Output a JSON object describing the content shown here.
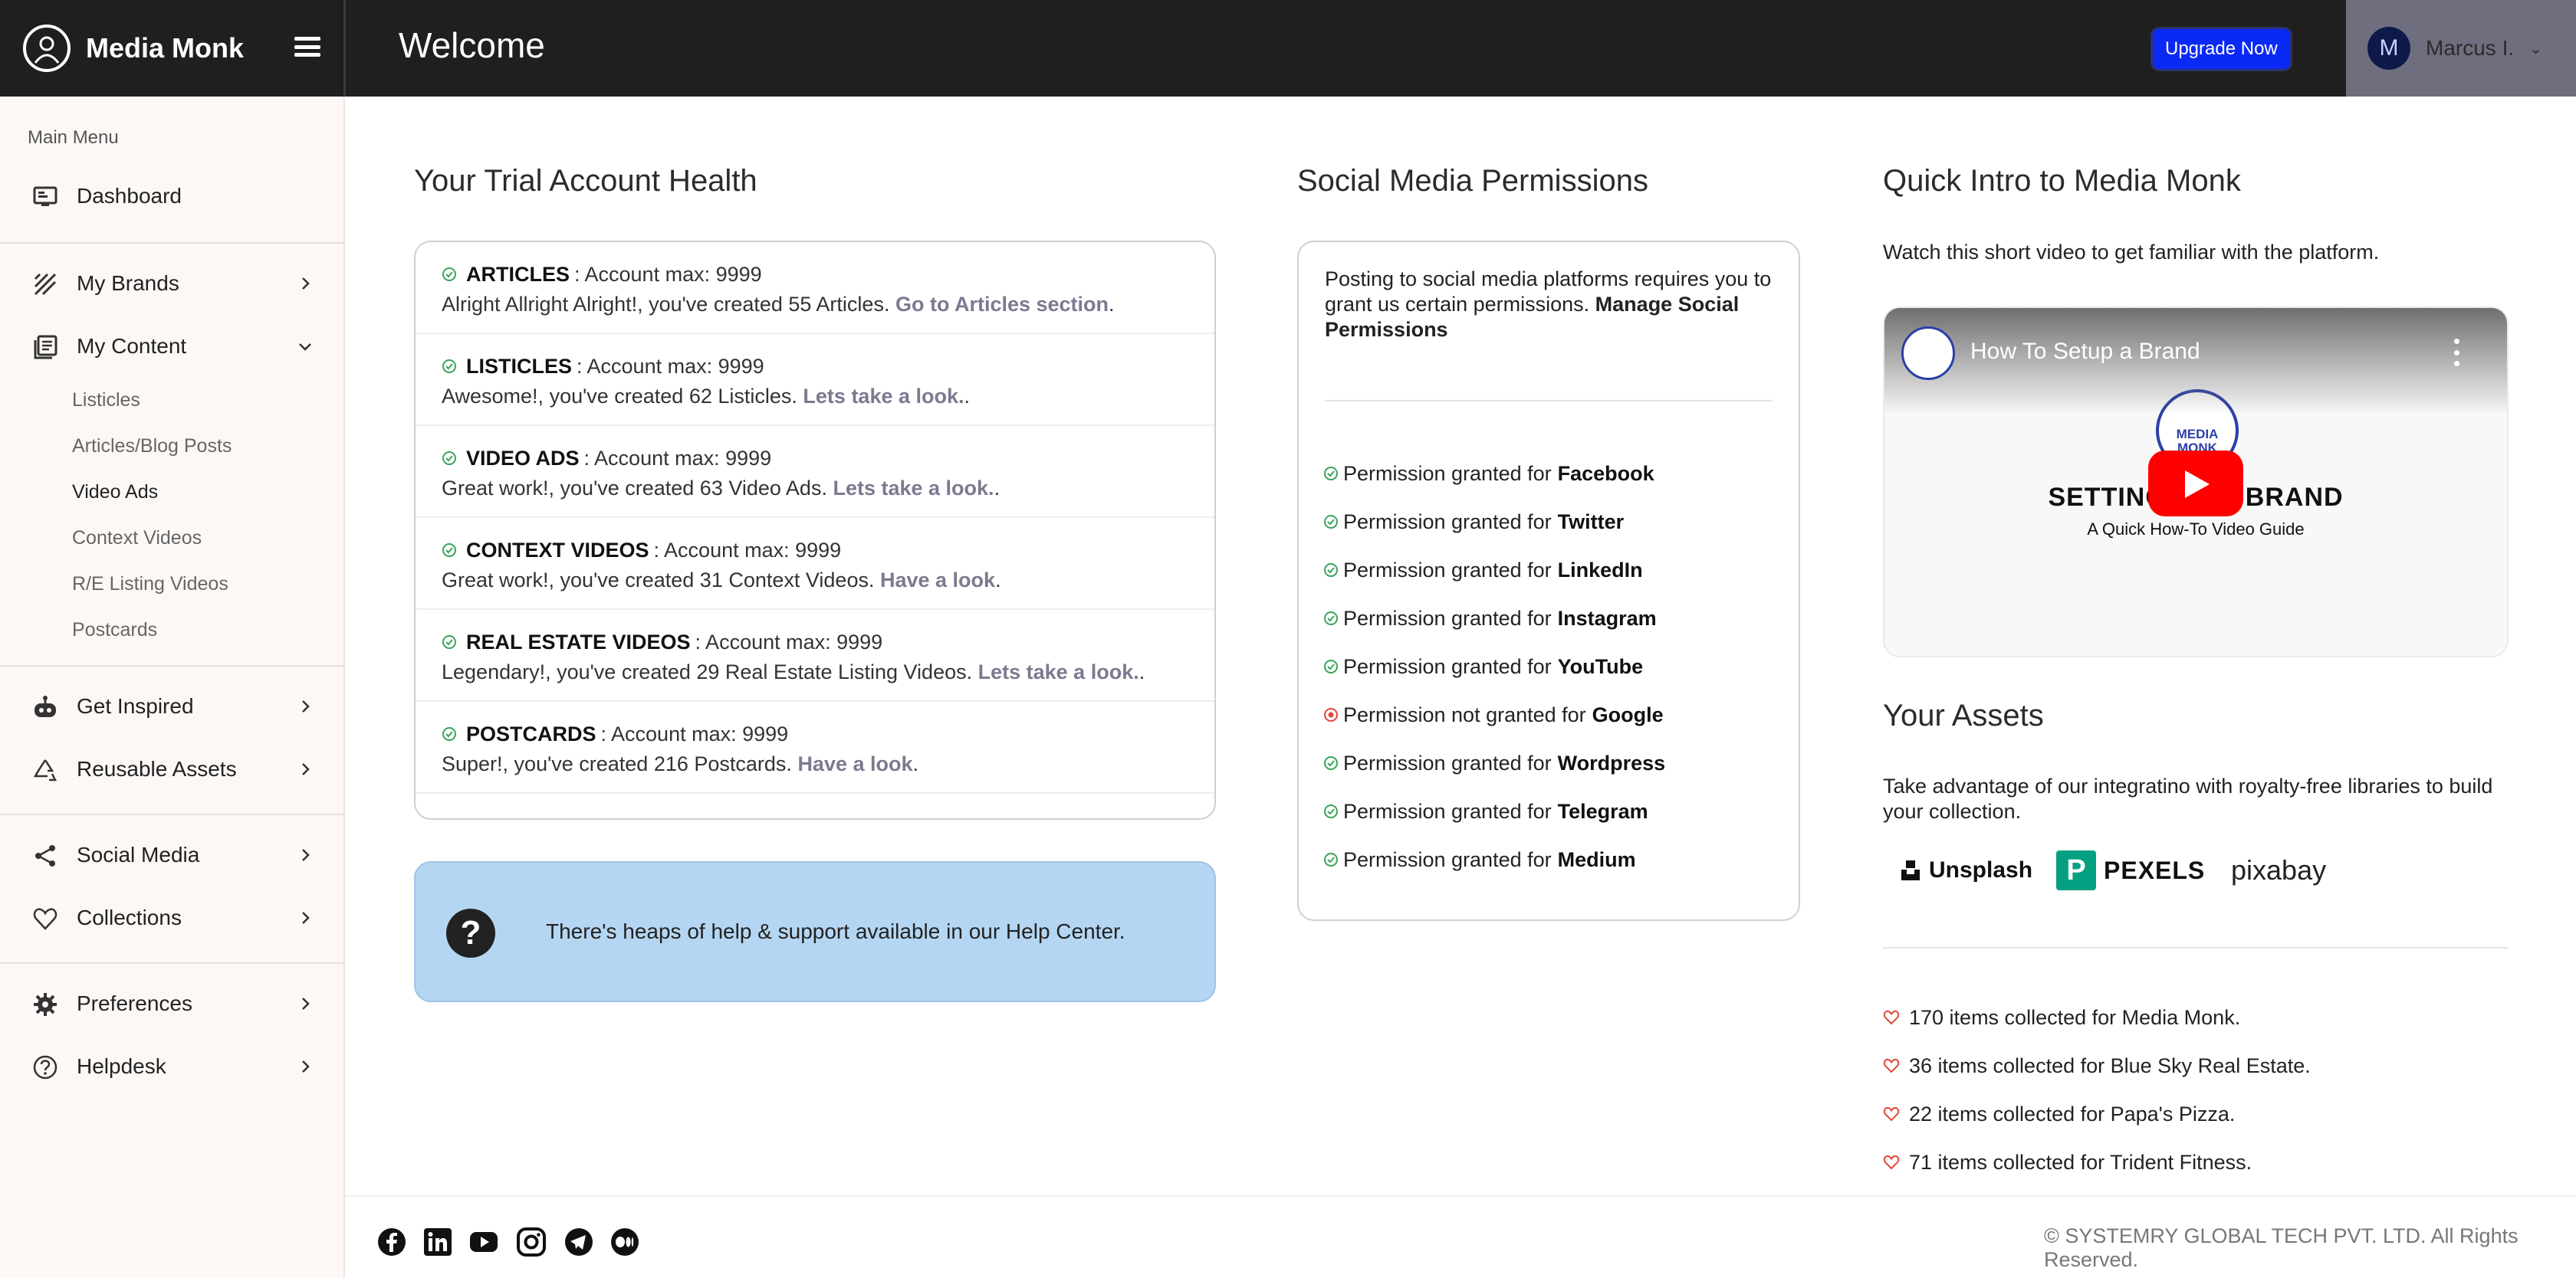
{
  "app": {
    "name": "Media Monk"
  },
  "header": {
    "title": "Welcome",
    "upgrade_label": "Upgrade Now",
    "user": {
      "initial": "M",
      "name": "Marcus I."
    }
  },
  "sidebar": {
    "heading": "Main Menu",
    "items": [
      {
        "label": "Dashboard",
        "icon": "monitor-icon"
      },
      {
        "label": "My Brands",
        "icon": "brands-icon"
      },
      {
        "label": "My Content",
        "icon": "content-icon",
        "expanded": true
      },
      {
        "label": "Get Inspired",
        "icon": "robot-icon"
      },
      {
        "label": "Reusable Assets",
        "icon": "recycle-icon"
      },
      {
        "label": "Social Media",
        "icon": "share-icon"
      },
      {
        "label": "Collections",
        "icon": "heart-icon"
      },
      {
        "label": "Preferences",
        "icon": "gear-icon"
      },
      {
        "label": "Helpdesk",
        "icon": "question-icon"
      }
    ],
    "content_sub": [
      "Listicles",
      "Articles/Blog Posts",
      "Video Ads",
      "Context Videos",
      "R/E Listing Videos",
      "Postcards"
    ],
    "active_sub": "Video Ads"
  },
  "health": {
    "title": "Your Trial Account Health",
    "rows": [
      {
        "type": "ARTICLES",
        "max": ": Account max: 9999",
        "message": "Alright Allright Alright!, you've created 55 Articles.",
        "link": "Go to Articles section",
        "tail": "."
      },
      {
        "type": "LISTICLES",
        "max": ": Account max: 9999",
        "message": "Awesome!, you've created 62 Listicles.",
        "link": "Lets take a look.",
        "tail": "."
      },
      {
        "type": "VIDEO ADS",
        "max": ": Account max: 9999",
        "message": "Great work!, you've created 63 Video Ads.",
        "link": "Lets take a look.",
        "tail": "."
      },
      {
        "type": "CONTEXT VIDEOS",
        "max": ": Account max: 9999",
        "message": "Great work!, you've created 31 Context Videos.",
        "link": "Have a look",
        "tail": "."
      },
      {
        "type": "REAL ESTATE VIDEOS",
        "max": ": Account max: 9999",
        "message": "Legendary!, you've created 29 Real Estate Listing Videos.",
        "link": "Lets take a look.",
        "tail": "."
      },
      {
        "type": "POSTCARDS",
        "max": ": Account max: 9999",
        "message": "Super!, you've created 216 Postcards.",
        "link": "Have a look",
        "tail": "."
      }
    ]
  },
  "help": {
    "text": "There's heaps of help & support available in our Help Center."
  },
  "permissions": {
    "title": "Social Media Permissions",
    "intro": "Posting to social media platforms requires you to grant us certain permissions.",
    "manage_link": "Manage Social Permissions",
    "rows": [
      {
        "text": "Permission granted for",
        "platform": "Facebook",
        "granted": true
      },
      {
        "text": "Permission granted for",
        "platform": "Twitter",
        "granted": true
      },
      {
        "text": "Permission granted for",
        "platform": "LinkedIn",
        "granted": true
      },
      {
        "text": "Permission granted for",
        "platform": "Instagram",
        "granted": true
      },
      {
        "text": "Permission granted for",
        "platform": "YouTube",
        "granted": true
      },
      {
        "text": "Permission not granted for",
        "platform": "Google",
        "granted": false
      },
      {
        "text": "Permission granted for",
        "platform": "Wordpress",
        "granted": true
      },
      {
        "text": "Permission granted for",
        "platform": "Telegram",
        "granted": true
      },
      {
        "text": "Permission granted for",
        "platform": "Medium",
        "granted": true
      }
    ]
  },
  "intro": {
    "title": "Quick Intro to Media Monk",
    "text": "Watch this short video to get familiar with the platform.",
    "video": {
      "title": "How To Setup a Brand",
      "logo_text_1": "MEDIA",
      "logo_text_2": "MONK",
      "heading": "SETTING UP A BRAND",
      "subheading": "A Quick How-To Video Guide"
    }
  },
  "assets": {
    "title": "Your Assets",
    "text": "Take advantage of our integratino with royalty-free libraries to build your collection.",
    "libraries": [
      "Unsplash",
      "PEXELS",
      "pixabay"
    ],
    "collections": [
      "170 items collected for Media Monk.",
      "36 items collected for Blue Sky Real Estate.",
      "22 items collected for Papa's Pizza.",
      "71 items collected for Trident Fitness."
    ]
  },
  "footer": {
    "social": [
      "facebook-icon",
      "linkedin-icon",
      "youtube-icon",
      "instagram-icon",
      "telegram-icon",
      "medium-icon"
    ],
    "copyright": "© SYSTEMRY GLOBAL TECH PVT. LTD. All Rights Reserved."
  },
  "colors": {
    "header_bg": "#1f1f1f",
    "upgrade_bg": "#0b29f5",
    "sidebar_bg": "#fdf8f5",
    "check_green": "#3aa35b",
    "denied_red": "#e0463c",
    "help_bg": "#b5d6f2",
    "heart_red": "#e0463c",
    "link_gray": "#7b7a90"
  }
}
